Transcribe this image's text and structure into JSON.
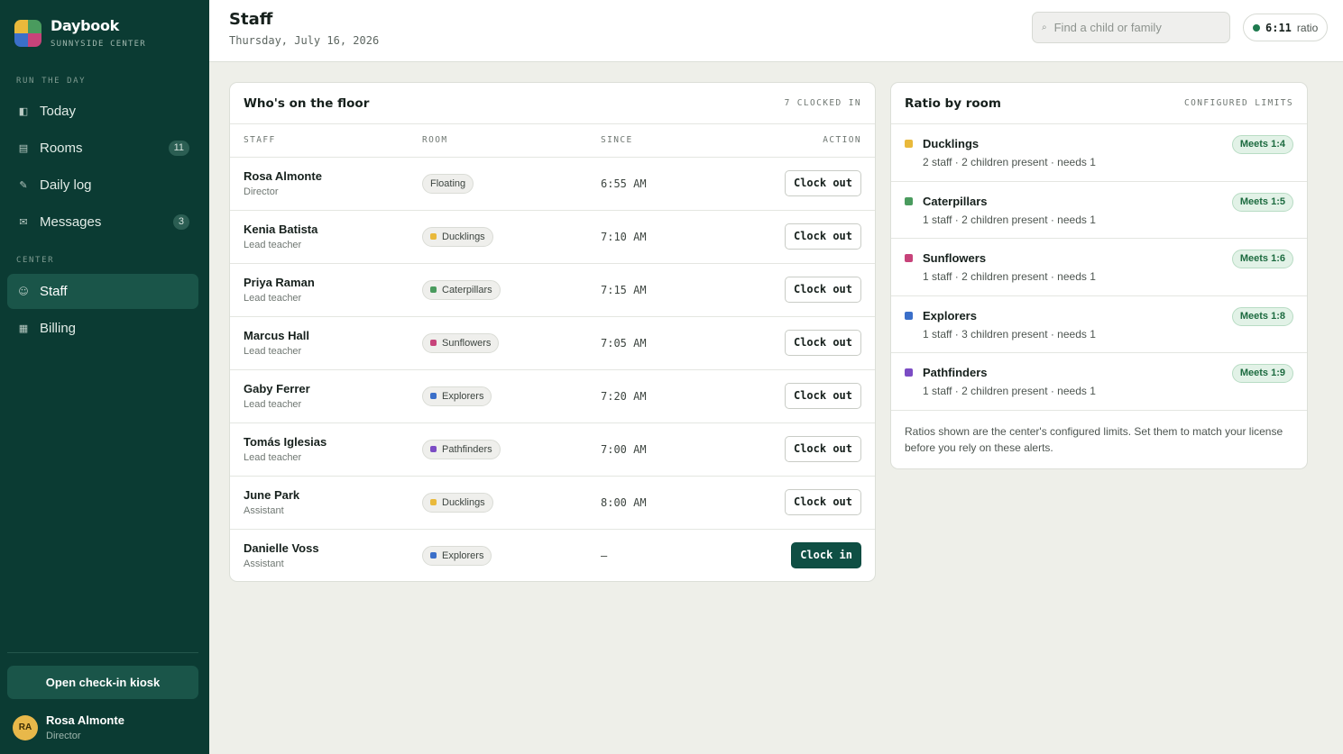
{
  "brand": {
    "name": "Daybook",
    "subtitle": "SUNNYSIDE CENTER",
    "logo_colors": [
      "#e9b93b",
      "#4a9b5e",
      "#3b6fc9",
      "#c7437a"
    ]
  },
  "nav": {
    "section_run": "RUN THE DAY",
    "section_center": "CENTER",
    "items": [
      {
        "label": "Today",
        "icon": "today-icon",
        "glyph": "◧",
        "badge": ""
      },
      {
        "label": "Rooms",
        "icon": "rooms-icon",
        "glyph": "▤",
        "badge": "11"
      },
      {
        "label": "Daily log",
        "icon": "pencil-icon",
        "glyph": "✎",
        "badge": ""
      },
      {
        "label": "Messages",
        "icon": "envelope-icon",
        "glyph": "✉",
        "badge": "3"
      },
      {
        "label": "Staff",
        "icon": "staff-icon",
        "glyph": "☺",
        "badge": "",
        "active": true
      },
      {
        "label": "Billing",
        "icon": "billing-icon",
        "glyph": "▦",
        "badge": ""
      }
    ]
  },
  "kiosk_button": "Open check-in kiosk",
  "user": {
    "initials": "RA",
    "name": "Rosa Almonte",
    "role": "Director"
  },
  "header": {
    "title": "Staff",
    "date": "Thursday, July 16, 2026",
    "search_placeholder": "Find a child or family",
    "ratio_value": "6:11",
    "ratio_label": "ratio",
    "ratio_status_color": "#1f7a4f"
  },
  "floor": {
    "title": "Who's on the floor",
    "meta": "7 CLOCKED IN",
    "columns": [
      "STAFF",
      "ROOM",
      "SINCE",
      "ACTION"
    ],
    "rows": [
      {
        "name": "Rosa Almonte",
        "role": "Director",
        "room": "Floating",
        "room_color": "",
        "since": "6:55 AM",
        "action": "Clock out",
        "action_type": "out"
      },
      {
        "name": "Kenia Batista",
        "role": "Lead teacher",
        "room": "Ducklings",
        "room_color": "#e9b93b",
        "since": "7:10 AM",
        "action": "Clock out",
        "action_type": "out"
      },
      {
        "name": "Priya Raman",
        "role": "Lead teacher",
        "room": "Caterpillars",
        "room_color": "#4a9b5e",
        "since": "7:15 AM",
        "action": "Clock out",
        "action_type": "out"
      },
      {
        "name": "Marcus Hall",
        "role": "Lead teacher",
        "room": "Sunflowers",
        "room_color": "#c7437a",
        "since": "7:05 AM",
        "action": "Clock out",
        "action_type": "out"
      },
      {
        "name": "Gaby Ferrer",
        "role": "Lead teacher",
        "room": "Explorers",
        "room_color": "#3b6fc9",
        "since": "7:20 AM",
        "action": "Clock out",
        "action_type": "out"
      },
      {
        "name": "Tomás Iglesias",
        "role": "Lead teacher",
        "room": "Pathfinders",
        "room_color": "#7b4cc4",
        "since": "7:00 AM",
        "action": "Clock out",
        "action_type": "out"
      },
      {
        "name": "June Park",
        "role": "Assistant",
        "room": "Ducklings",
        "room_color": "#e9b93b",
        "since": "8:00 AM",
        "action": "Clock out",
        "action_type": "out"
      },
      {
        "name": "Danielle Voss",
        "role": "Assistant",
        "room": "Explorers",
        "room_color": "#3b6fc9",
        "since": "—",
        "action": "Clock in",
        "action_type": "in"
      }
    ]
  },
  "ratios": {
    "title": "Ratio by room",
    "meta": "CONFIGURED LIMITS",
    "rooms": [
      {
        "name": "Ducklings",
        "color": "#e9b93b",
        "detail": "2 staff · 2 children present · needs 1",
        "status": "Meets 1:4"
      },
      {
        "name": "Caterpillars",
        "color": "#4a9b5e",
        "detail": "1 staff · 2 children present · needs 1",
        "status": "Meets 1:5"
      },
      {
        "name": "Sunflowers",
        "color": "#c7437a",
        "detail": "1 staff · 2 children present · needs 1",
        "status": "Meets 1:6"
      },
      {
        "name": "Explorers",
        "color": "#3b6fc9",
        "detail": "1 staff · 3 children present · needs 1",
        "status": "Meets 1:8"
      },
      {
        "name": "Pathfinders",
        "color": "#7b4cc4",
        "detail": "1 staff · 2 children present · needs 1",
        "status": "Meets 1:9"
      }
    ],
    "note": "Ratios shown are the center's configured limits. Set them to match your license before you rely on these alerts."
  }
}
